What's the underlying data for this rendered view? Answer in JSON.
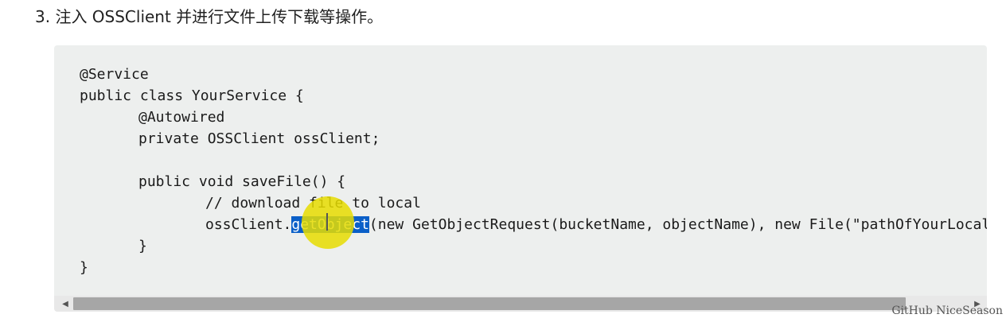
{
  "heading": {
    "text": "3. 注入 OSSClient 并进行文件上传下载等操作。"
  },
  "code": {
    "line1": "@Service",
    "line2": "public class YourService {",
    "line3": "@Autowired",
    "line4": "private OSSClient ossClient;",
    "line5": "",
    "line6": "public void saveFile() {",
    "line7": "// download file to local",
    "line8_prefix": "ossClient.",
    "line8_selected": "getObject",
    "line8_suffix": "(new GetObjectRequest(bucketName, objectName), new File(\"pathOfYourLocalFile\"));",
    "line9": "}",
    "line10": "}"
  },
  "scrollbar": {
    "left_arrow_icon": "triangle-left-icon",
    "right_arrow_icon": "triangle-right-icon"
  },
  "watermark": {
    "text": "GitHub NiceSeason"
  },
  "colors": {
    "code_background": "#edefee",
    "selection": "#0a5fc8",
    "cursor_highlight": "#e6dc00",
    "scroll_thumb": "#a6a6a6"
  }
}
